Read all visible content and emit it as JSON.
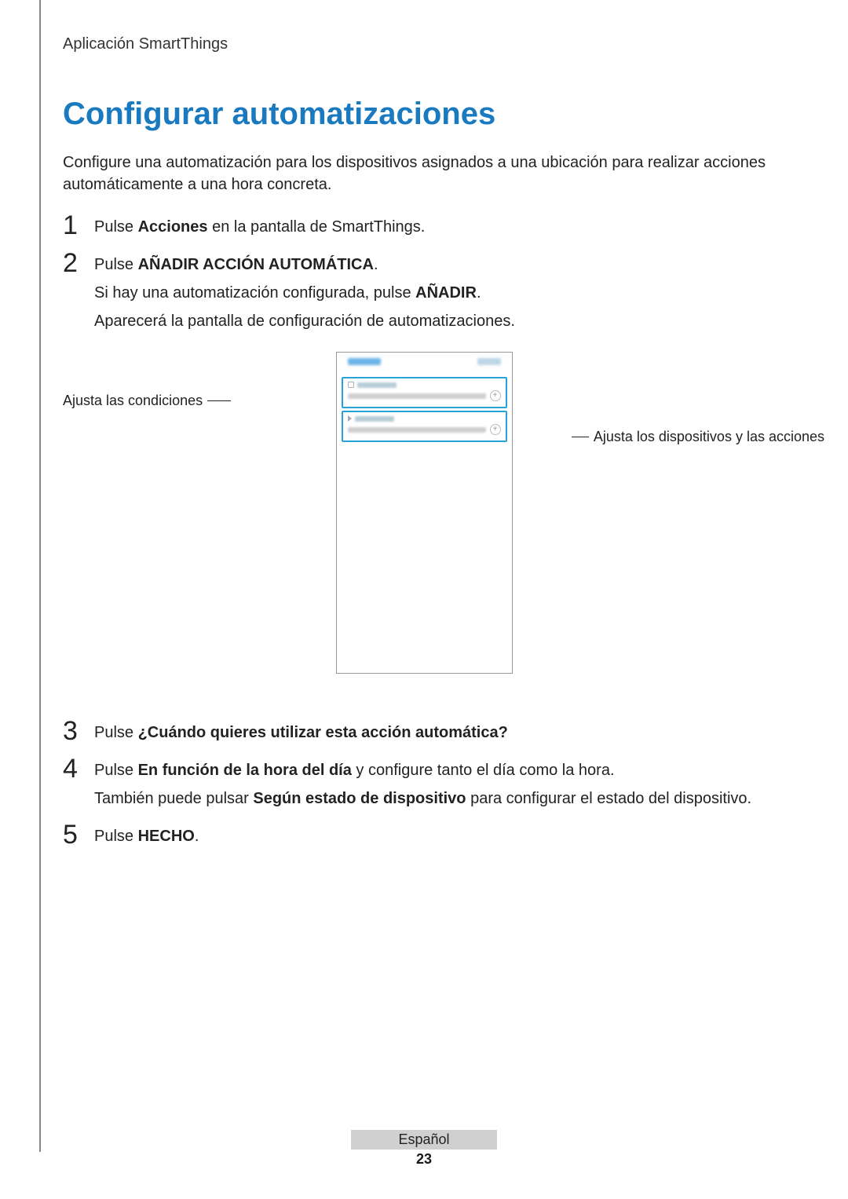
{
  "header": "Aplicación SmartThings",
  "title": "Configurar automatizaciones",
  "intro": "Configure una automatización para los dispositivos asignados a una ubicación para realizar acciones automáticamente a una hora concreta.",
  "steps": {
    "s1": {
      "num": "1",
      "pre": "Pulse ",
      "bold": "Acciones",
      "post": " en la pantalla de SmartThings."
    },
    "s2": {
      "num": "2",
      "line1_pre": "Pulse ",
      "line1_bold": "AÑADIR ACCIÓN AUTOMÁTICA",
      "line1_post": ".",
      "line2_pre": "Si hay una automatización configurada, pulse ",
      "line2_bold": "AÑADIR",
      "line2_post": ".",
      "line3": "Aparecerá la pantalla de configuración de automatizaciones."
    },
    "s3": {
      "num": "3",
      "pre": "Pulse ",
      "bold": "¿Cuándo quieres utilizar esta acción automática?"
    },
    "s4": {
      "num": "4",
      "line1_pre": "Pulse ",
      "line1_bold": "En función de la hora del día",
      "line1_post": " y configure tanto el día como la hora.",
      "line2_pre": "También puede pulsar ",
      "line2_bold": "Según estado de dispositivo",
      "line2_post": " para configurar el estado del dispositivo."
    },
    "s5": {
      "num": "5",
      "pre": "Pulse ",
      "bold": "HECHO",
      "post": "."
    }
  },
  "callouts": {
    "left": "Ajusta las condiciones",
    "right": "Ajusta los dispositivos y las acciones"
  },
  "footer": {
    "language": "Español",
    "page": "23"
  }
}
